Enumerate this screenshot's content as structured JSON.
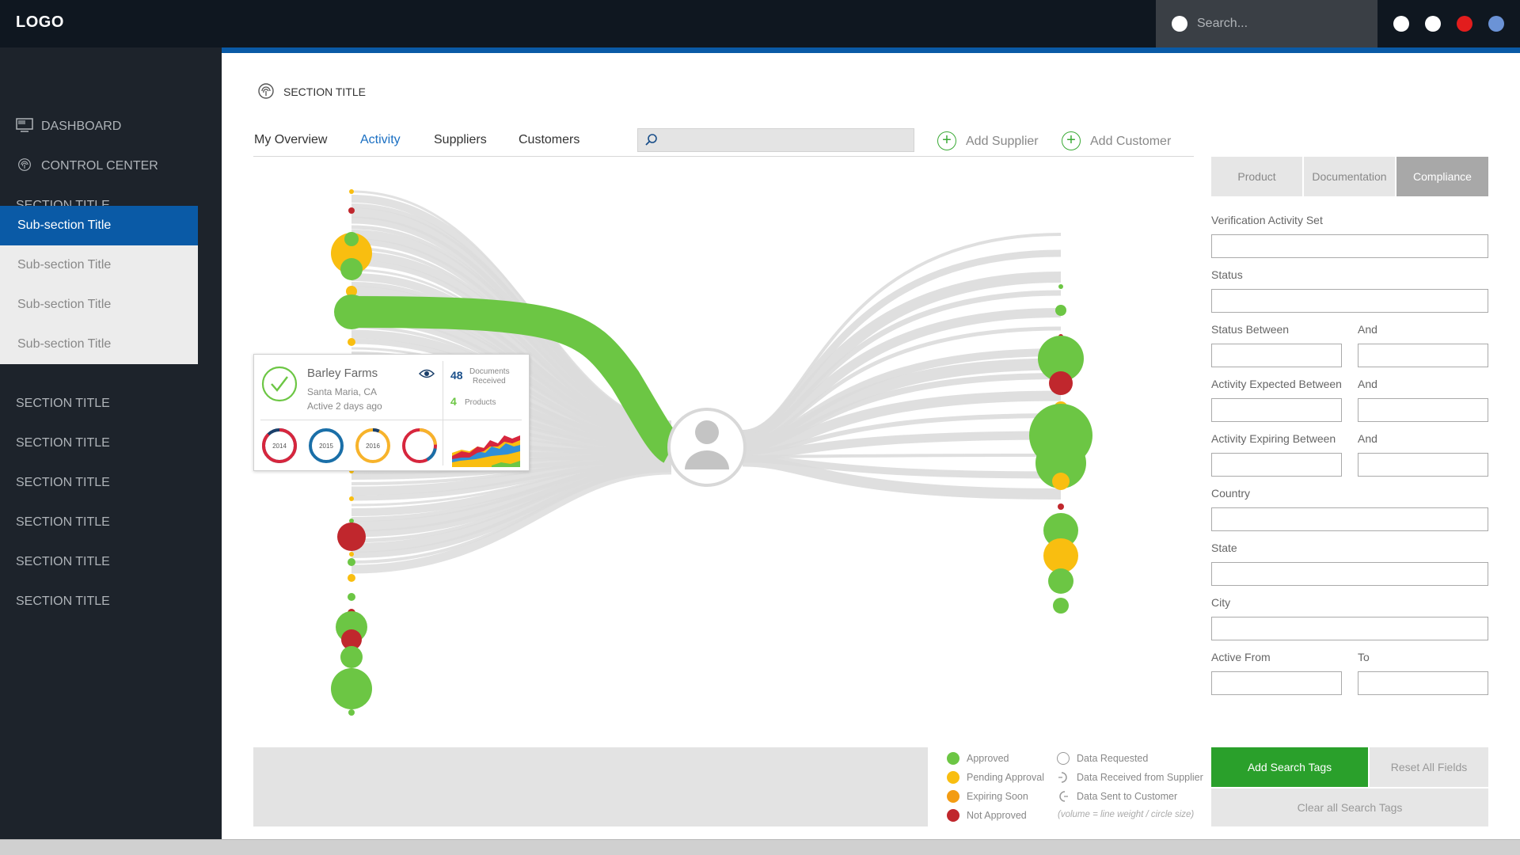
{
  "topbar": {
    "logo": "LOGO",
    "search_placeholder": "Search...",
    "indicator_colors": [
      "#ffffff",
      "#ffffff",
      "#e21d1d",
      "#6b93d6"
    ]
  },
  "sidebar": {
    "items": [
      {
        "label": "DASHBOARD",
        "icon": "monitor-icon"
      },
      {
        "label": "CONTROL CENTER",
        "icon": "fingerprint-icon"
      },
      {
        "label": "SECTION TITLE"
      }
    ],
    "subsections": [
      {
        "label": "Sub-section Title",
        "active": true
      },
      {
        "label": "Sub-section Title",
        "active": false
      },
      {
        "label": "Sub-section Title",
        "active": false
      },
      {
        "label": "Sub-section Title",
        "active": false
      }
    ],
    "more_sections": [
      "SECTION TITLE",
      "SECTION TITLE",
      "SECTION TITLE",
      "SECTION TITLE",
      "SECTION TITLE",
      "SECTION TITLE"
    ]
  },
  "main": {
    "section_title": "SECTION TITLE",
    "section_icon": "fingerprint-icon",
    "tabs": [
      {
        "label": "My Overview",
        "active": false
      },
      {
        "label": "Activity",
        "active": true
      },
      {
        "label": "Suppliers",
        "active": false
      },
      {
        "label": "Customers",
        "active": false
      }
    ],
    "filter_icon": "search-icon",
    "filter_value": "",
    "add_supplier": "Add Supplier",
    "add_customer": "Add Customer"
  },
  "card": {
    "name": "Barley Farms",
    "location": "Santa Maria, CA",
    "activity": "Active 2 days ago",
    "documents_count": "48",
    "documents_label_1": "Documents",
    "documents_label_2": "Received",
    "products_count": "4",
    "products_label": "Products",
    "years": [
      {
        "label": "2014",
        "color": "#d7263d"
      },
      {
        "label": "2015",
        "color": "#1a6fa8"
      },
      {
        "label": "2016",
        "color": "#f7b32b"
      },
      {
        "label": "",
        "color": "#d7263d"
      }
    ],
    "status_icon": "check-circle-icon",
    "eye_icon": "eye-icon"
  },
  "filters": {
    "tabs": [
      {
        "label": "Product",
        "active": false
      },
      {
        "label": "Documentation",
        "active": false
      },
      {
        "label": "Compliance",
        "active": true
      }
    ],
    "verification_activity_set": "Verification Activity Set",
    "status": "Status",
    "status_between": "Status Between",
    "and": "And",
    "activity_expected_between": "Activity Expected Between",
    "activity_expiring_between": "Activity Expiring Between",
    "country": "Country",
    "state": "State",
    "city": "City",
    "active_from": "Active From",
    "to": "To"
  },
  "legend": {
    "approved": "Approved",
    "pending": "Pending Approval",
    "expiring": "Expiring Soon",
    "not_approved": "Not Approved",
    "data_requested": "Data Requested",
    "data_received": "Data Received from Supplier",
    "data_sent": "Data Sent to Customer",
    "note": "(volume = line weight / circle size)",
    "colors": {
      "approved": "#6cc644",
      "pending": "#f9be10",
      "expiring": "#f39c12",
      "not_approved": "#c0272d"
    }
  },
  "buttons": {
    "add_search_tags": "Add Search Tags",
    "reset_all_fields": "Reset All Fields",
    "clear_all_search_tags": "Clear all Search Tags"
  }
}
